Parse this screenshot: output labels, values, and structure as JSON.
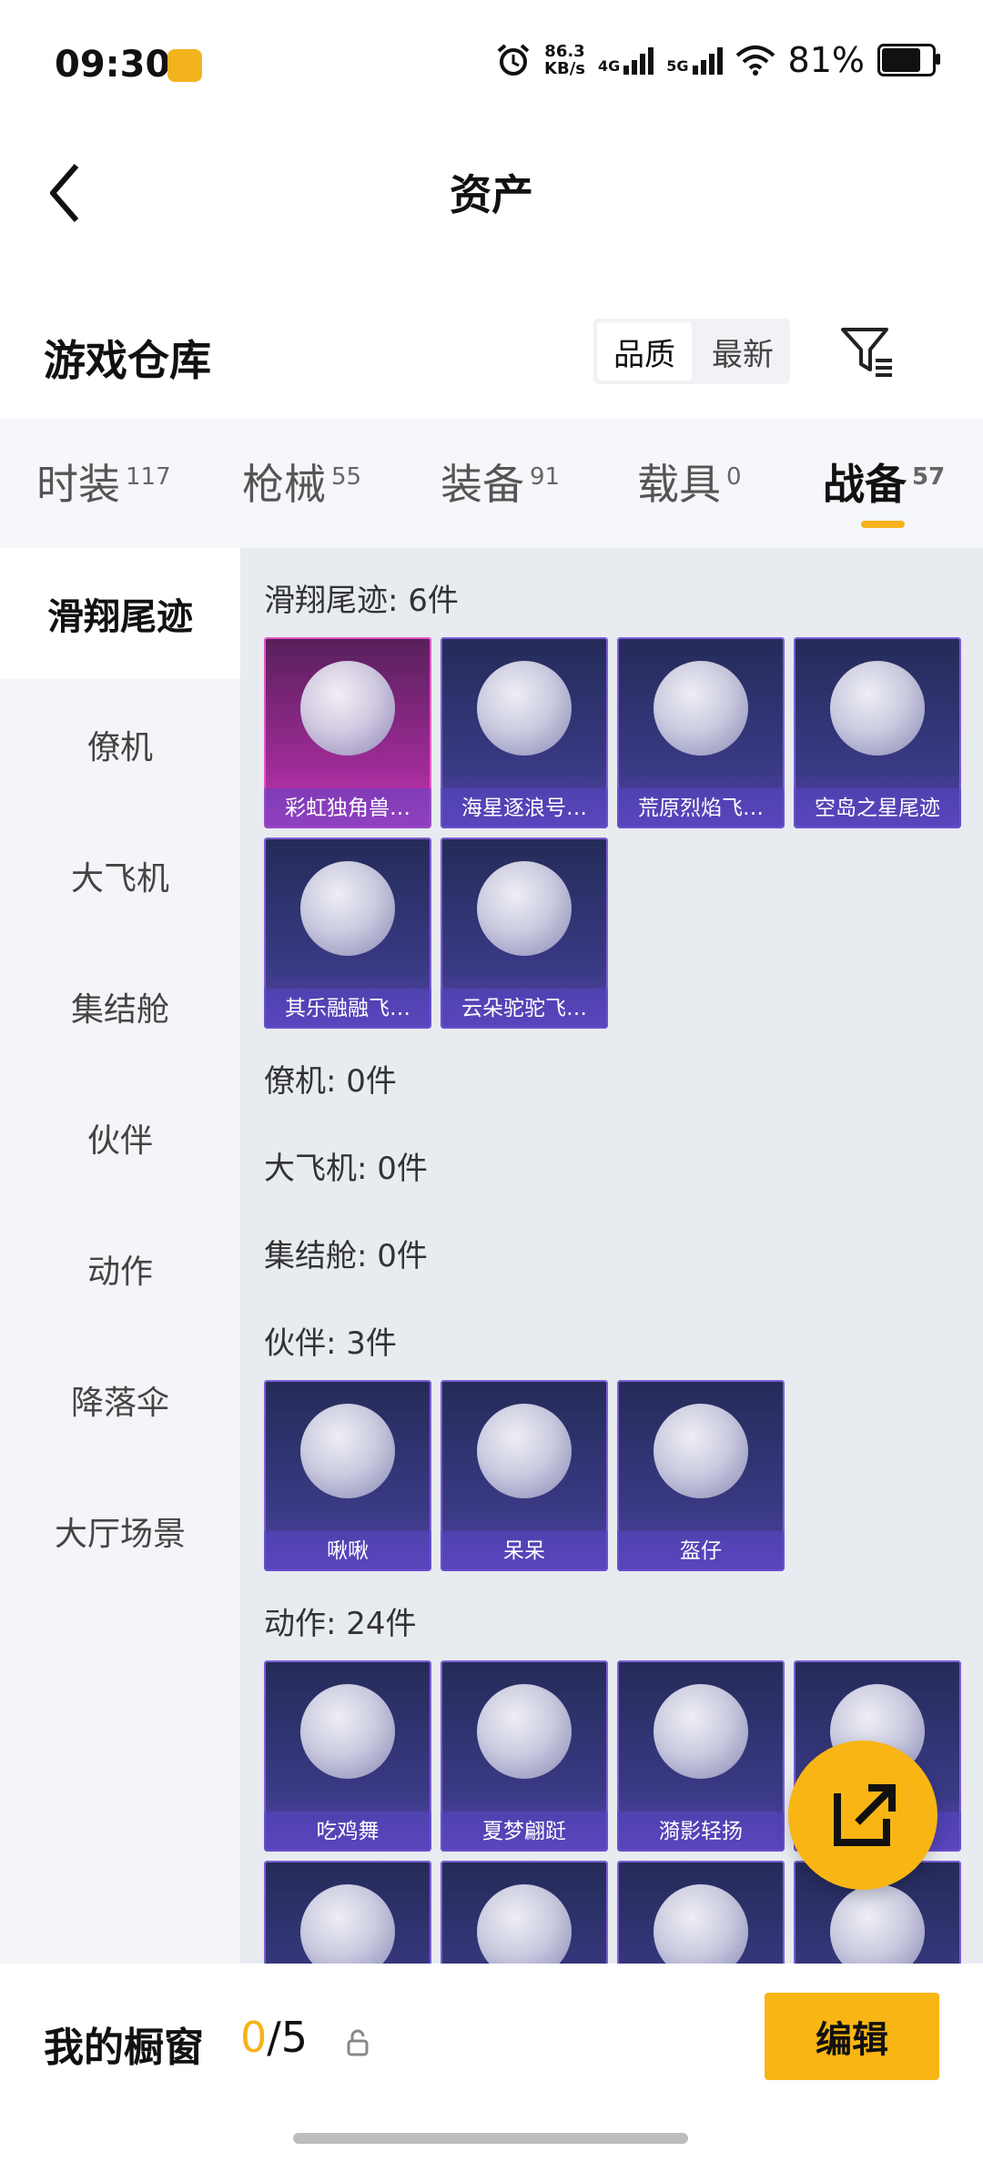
{
  "status_bar": {
    "time": "09:30",
    "net_speed_value": "86.3",
    "net_speed_unit": "KB/s",
    "net_4g": "4G",
    "net_5g": "5G",
    "battery": "81%",
    "battery_level_pct": 81
  },
  "header": {
    "title": "资产"
  },
  "warehouse": {
    "label": "游戏仓库",
    "sort_options": [
      "品质",
      "最新"
    ],
    "selected_sort": "品质"
  },
  "tabs": [
    {
      "label": "时装",
      "count": "117"
    },
    {
      "label": "枪械",
      "count": "55"
    },
    {
      "label": "装备",
      "count": "91"
    },
    {
      "label": "载具",
      "count": "0"
    },
    {
      "label": "战备",
      "count": "57"
    }
  ],
  "active_tab": "战备",
  "sidebar": [
    {
      "label": "滑翔尾迹"
    },
    {
      "label": "僚机"
    },
    {
      "label": "大飞机"
    },
    {
      "label": "集结舱"
    },
    {
      "label": "伙伴"
    },
    {
      "label": "动作"
    },
    {
      "label": "降落伞"
    },
    {
      "label": "大厅场景"
    }
  ],
  "sections": {
    "glide": {
      "title": "滑翔尾迹: 6件",
      "items": [
        "彩虹独角兽…",
        "海星逐浪号…",
        "荒原烈焰飞…",
        "空岛之星尾迹",
        "其乐融融飞…",
        "云朵驼驼飞…"
      ]
    },
    "wingman": {
      "title": "僚机: 0件"
    },
    "big_plane": {
      "title": "大飞机: 0件"
    },
    "assembly": {
      "title": "集结舱: 0件"
    },
    "partner": {
      "title": "伙伴: 3件",
      "items": [
        "啾啾",
        "呆呆",
        "盔仔"
      ]
    },
    "actions": {
      "title": "动作: 24件",
      "items": [
        "吃鸡舞",
        "夏梦翩跹",
        "漪影轻扬",
        "",
        "",
        "",
        "",
        ""
      ]
    }
  },
  "bottom_bar": {
    "label": "我的橱窗",
    "count_current": "0",
    "count_total": "/5",
    "edit_label": "编辑"
  },
  "colors": {
    "accent": "#f8b514",
    "card_purple": "#3a3a86",
    "card_pink": "#a02b98"
  }
}
